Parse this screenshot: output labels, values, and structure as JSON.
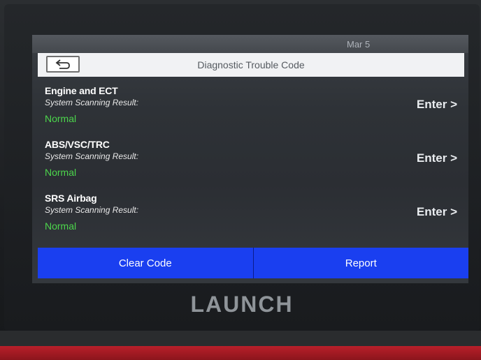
{
  "screen": {
    "status_date": "Mar 5",
    "title": "Diagnostic Trouble Code"
  },
  "systems": [
    {
      "name": "Engine and ECT",
      "result_label": "System Scanning Result:",
      "status": "Normal",
      "enter_label": "Enter >"
    },
    {
      "name": "ABS/VSC/TRC",
      "result_label": "System Scanning Result:",
      "status": "Normal",
      "enter_label": "Enter >"
    },
    {
      "name": "SRS Airbag",
      "result_label": "System Scanning Result:",
      "status": "Normal",
      "enter_label": "Enter >"
    }
  ],
  "actions": {
    "clear_code": "Clear Code",
    "report": "Report"
  },
  "device": {
    "brand": "LAUNCH"
  },
  "icons": {
    "back": "back-arrow-icon"
  },
  "colors": {
    "normal_status": "#4cd64c",
    "button_blue": "#1a3ff0"
  }
}
